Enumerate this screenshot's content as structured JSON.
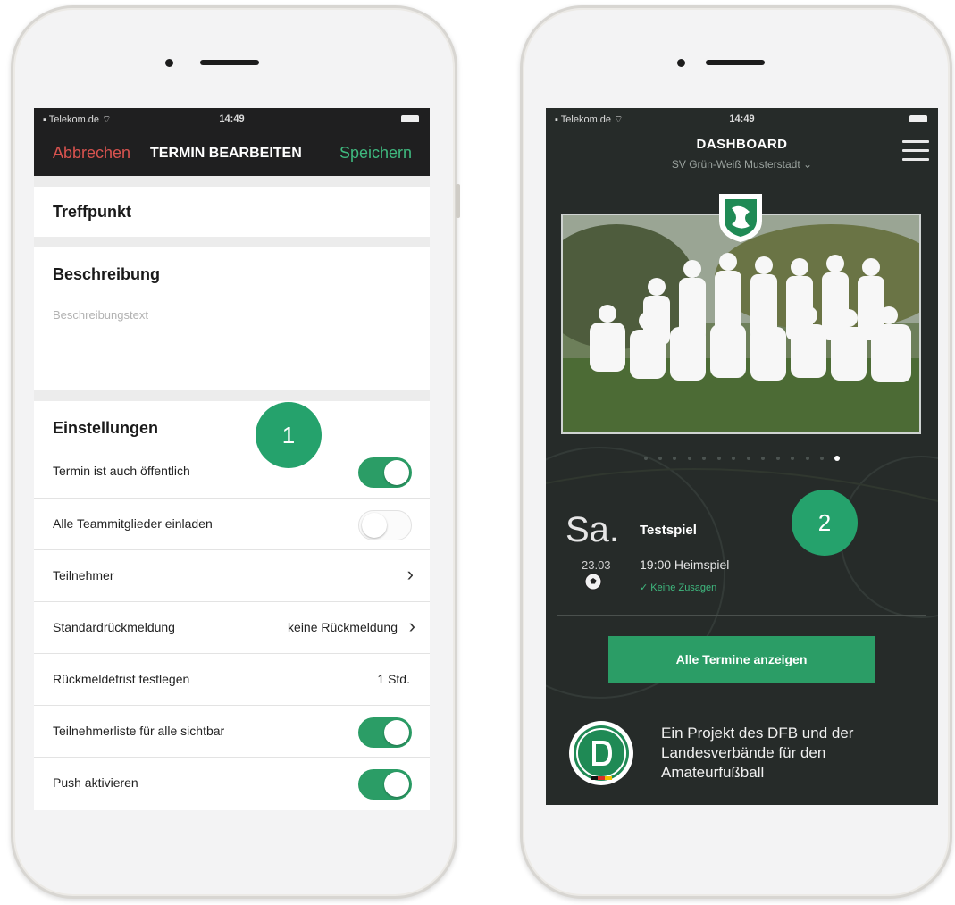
{
  "left_screen": {
    "status": {
      "carrier": "Telekom.de",
      "time": "14:49"
    },
    "nav": {
      "cancel_label": "Abbrechen",
      "title": "TERMIN BEARBEITEN",
      "save_label": "Speichern"
    },
    "treffpunkt_label": "Treffpunkt",
    "beschreibung": {
      "title": "Beschreibung",
      "placeholder": "Beschreibungstext"
    },
    "einstellungen": {
      "title": "Einstellungen",
      "rows": [
        {
          "label": "Termin ist auch öffentlich",
          "toggle": true
        },
        {
          "label": "Alle Teammitglieder einladen",
          "toggle": false
        },
        {
          "label": "Teilnehmer"
        },
        {
          "label": "Standardrückmeldung",
          "value": "keine Rückmeldung"
        },
        {
          "label": "Rückmeldefrist festlegen",
          "value": "1 Std."
        },
        {
          "label": "Teilnehmerliste für alle  sichtbar",
          "toggle": true
        },
        {
          "label": "Push aktivieren",
          "toggle": true
        }
      ]
    },
    "badge": "1"
  },
  "right_screen": {
    "status": {
      "carrier": "Telekom.de",
      "time": "14:49"
    },
    "title": "DASHBOARD",
    "team": "SV Grün-Weiß Musterstadt",
    "carousel": {
      "total": 14,
      "active_index": 13
    },
    "event": {
      "day": "Sa.",
      "date": "23.03",
      "name": "Testspiel",
      "time_info": "19:00  Heimspiel",
      "zusagen": "Keine Zusagen"
    },
    "button_label": "Alle Termine anzeigen",
    "dfb_text": "Ein Projekt des DFB und der Landesverbände für den Amateurfußball",
    "badge": "2"
  },
  "colors": {
    "accent_green": "#2b9d66",
    "cancel_red": "#d9534f",
    "save_green": "#3fb97f",
    "dark_header": "#1f1f20",
    "dashboard_bg": "#262b29"
  },
  "icons": [
    "wifi-icon",
    "battery-icon",
    "chevron-right-icon",
    "hamburger-menu-icon",
    "chevron-down-icon",
    "club-crest-icon",
    "football-icon",
    "checkmark-icon",
    "dfb-logo-icon"
  ]
}
